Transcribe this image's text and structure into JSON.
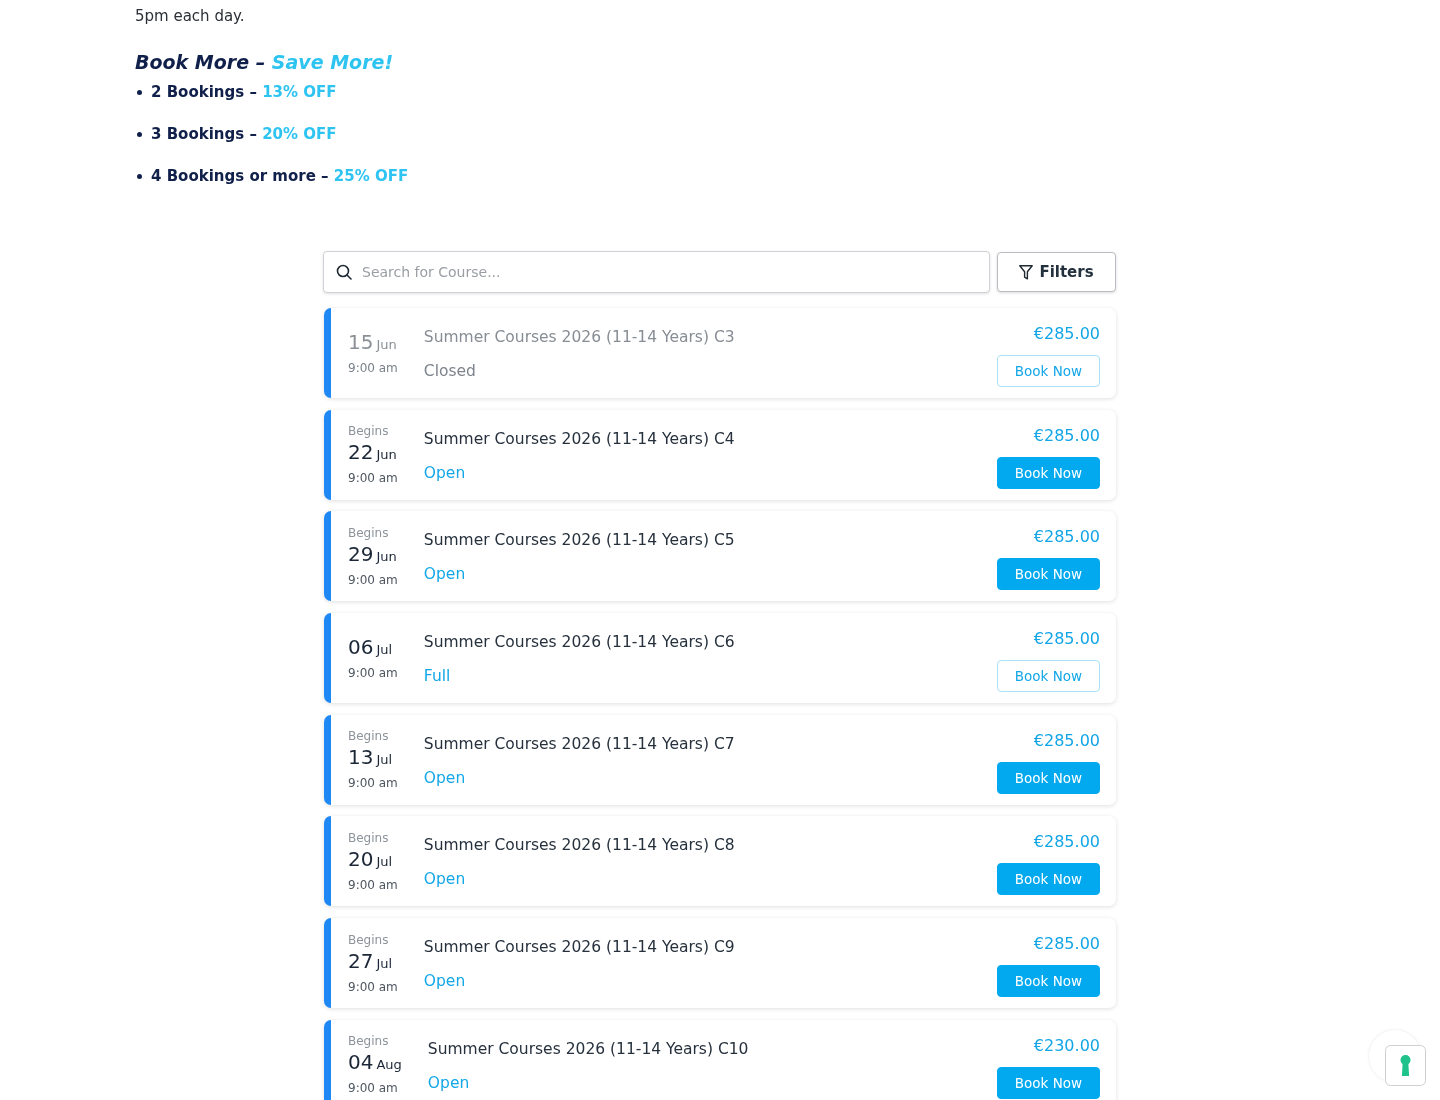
{
  "intro": {
    "text": "5pm each day."
  },
  "offer": {
    "title": "Book More –",
    "accent": "Save More!",
    "items": [
      {
        "label": "2 Bookings –",
        "discount": "13% OFF"
      },
      {
        "label": "3 Bookings –",
        "discount": "20% OFF"
      },
      {
        "label": "4 Bookings or more –",
        "discount": "25% OFF"
      }
    ]
  },
  "search": {
    "placeholder": "Search for Course..."
  },
  "filters_button": {
    "label": "Filters"
  },
  "courses": [
    {
      "kind": "closed",
      "day": "15",
      "month": "Jun",
      "time": "9:00 am",
      "title": "Summer Courses 2026 (11-14 Years) C3",
      "status": "Closed",
      "price": "€285.00",
      "button": "Book Now"
    },
    {
      "kind": "open",
      "begins": "Begins",
      "day": "22",
      "month": "Jun",
      "time": "9:00 am",
      "title": "Summer Courses 2026 (11-14 Years) C4",
      "status": "Open",
      "price": "€285.00",
      "button": "Book Now"
    },
    {
      "kind": "open",
      "begins": "Begins",
      "day": "29",
      "month": "Jun",
      "time": "9:00 am",
      "title": "Summer Courses 2026 (11-14 Years) C5",
      "status": "Open",
      "price": "€285.00",
      "button": "Book Now"
    },
    {
      "kind": "full",
      "day": "06",
      "month": "Jul",
      "time": "9:00 am",
      "title": "Summer Courses 2026 (11-14 Years) C6",
      "status": "Full",
      "price": "€285.00",
      "button": "Book Now"
    },
    {
      "kind": "open",
      "begins": "Begins",
      "day": "13",
      "month": "Jul",
      "time": "9:00 am",
      "title": "Summer Courses 2026 (11-14 Years) C7",
      "status": "Open",
      "price": "€285.00",
      "button": "Book Now"
    },
    {
      "kind": "open",
      "begins": "Begins",
      "day": "20",
      "month": "Jul",
      "time": "9:00 am",
      "title": "Summer Courses 2026 (11-14 Years) C8",
      "status": "Open",
      "price": "€285.00",
      "button": "Book Now"
    },
    {
      "kind": "open",
      "begins": "Begins",
      "day": "27",
      "month": "Jul",
      "time": "9:00 am",
      "title": "Summer Courses 2026 (11-14 Years) C9",
      "status": "Open",
      "price": "€285.00",
      "button": "Book Now"
    },
    {
      "kind": "open",
      "begins": "Begins",
      "day": "04",
      "month": "Aug",
      "time": "9:00 am",
      "title": "Summer Courses 2026 (11-14 Years) C10",
      "status": "Open",
      "price": "€230.00",
      "button": "Book Now"
    }
  ]
}
